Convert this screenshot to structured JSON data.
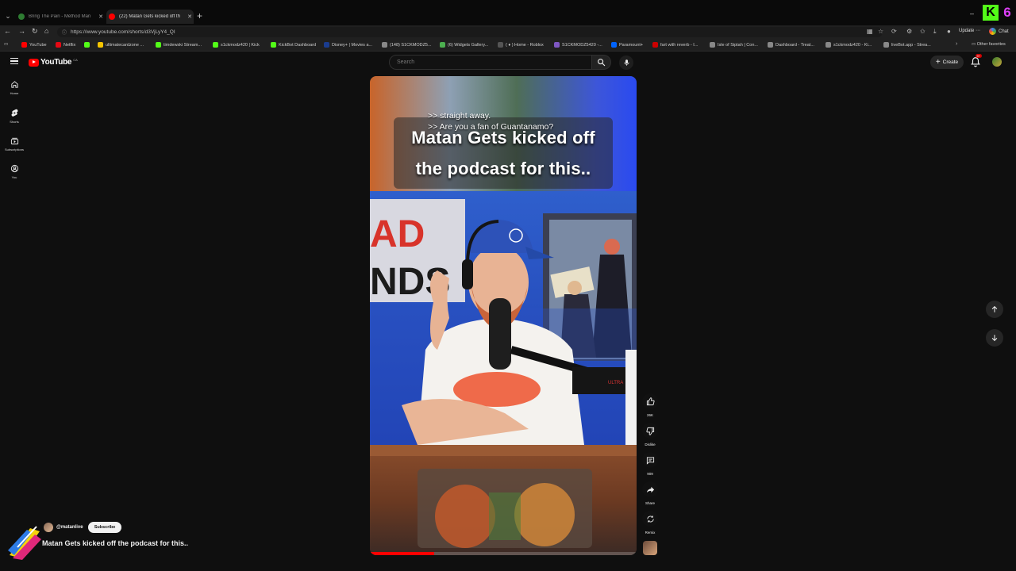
{
  "browser": {
    "tabs": [
      {
        "title": "Bring The Pain - Method Man",
        "active": false,
        "favicon_color": "#2e7d32"
      },
      {
        "title": "(22) Matan Gets kicked off th",
        "active": true,
        "favicon_color": "#ff0000"
      }
    ],
    "url": "https://www.youtube.com/shorts/d3VjLyY4_QI",
    "update_label": "Update",
    "chat_label": "Chat",
    "bookmarks": [
      {
        "label": "YouTube",
        "color": "#ff0000"
      },
      {
        "label": "Netflix",
        "color": "#e50914"
      },
      {
        "label": "ultimatecardzone ...",
        "color": "#f5c400"
      },
      {
        "label": "timdewski Stream...",
        "color": "#53fc18"
      },
      {
        "label": "s1ckmodz420 | Kick",
        "color": "#53fc18"
      },
      {
        "label": "KickBot Dashboard",
        "color": "#53fc18"
      },
      {
        "label": "Disney+ | Movies a...",
        "color": "#1a3c8f"
      },
      {
        "label": "(148) S1CKMODZ5...",
        "color": "#888888"
      },
      {
        "label": "(6) Widgets Gallery...",
        "color": "#4caf50"
      },
      {
        "label": "( ♦ ) Home - Roblox",
        "color": "#555555"
      },
      {
        "label": "S1CKMODZ5420 -...",
        "color": "#7e57c2"
      },
      {
        "label": "Paramount+",
        "color": "#0064ff"
      },
      {
        "label": "fart with reverb - I...",
        "color": "#cc0000"
      },
      {
        "label": "Isle of Siptah | Con...",
        "color": "#888888"
      },
      {
        "label": "Dashboard - Treat...",
        "color": "#888888"
      },
      {
        "label": "s1ckmodz420 - Ki...",
        "color": "#888888"
      },
      {
        "label": "liveBot.app - Strea...",
        "color": "#888888"
      }
    ],
    "other_favorites_label": "Other favorites"
  },
  "youtube": {
    "logo_text": "YouTube",
    "country_code": "CA",
    "search_placeholder": "Search",
    "create_label": "Create",
    "notification_badge": "9+",
    "guide": [
      {
        "label": "Home",
        "icon": "home-icon"
      },
      {
        "label": "Shorts",
        "icon": "shorts-icon"
      },
      {
        "label": "Subscriptions",
        "icon": "subscriptions-icon"
      },
      {
        "label": "You",
        "icon": "you-icon"
      }
    ]
  },
  "short": {
    "overlay_title_line1": "Matan Gets kicked off",
    "overlay_title_line2": "the podcast for this..",
    "caption_line1": ">> straight away.",
    "caption_line2": ">> Are you a fan of Guantanamo?",
    "title": "Matan Gets kicked off the podcast for this..",
    "channel": "@matanlive",
    "subscribe_label": "Subscribe",
    "progress": 0.24,
    "actions": {
      "like_count": "26K",
      "dislike_label": "Dislike",
      "comment_count": "909",
      "share_label": "Share",
      "remix_label": "Remix"
    }
  },
  "colors": {
    "accent": "#ff0000",
    "background": "#0f0f0f",
    "kick_green": "#53fc18"
  }
}
